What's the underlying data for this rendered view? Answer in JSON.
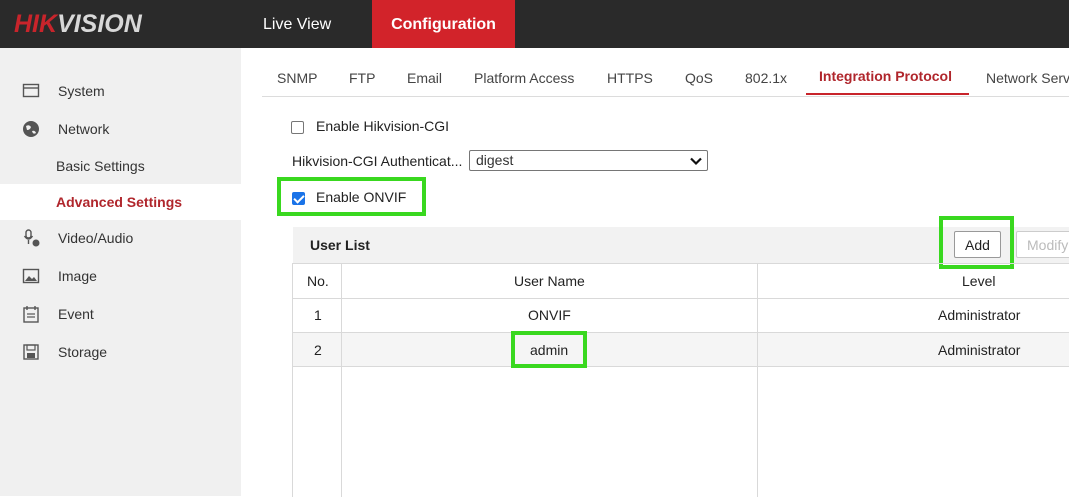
{
  "header": {
    "logo_red": "HIK",
    "logo_rest": "VISION",
    "nav": [
      {
        "label": "Live View"
      },
      {
        "label": "Configuration"
      }
    ]
  },
  "sidebar": {
    "items": [
      {
        "label": "System",
        "icon": "monitor-icon"
      },
      {
        "label": "Network",
        "icon": "globe-icon"
      },
      {
        "label": "Basic Settings"
      },
      {
        "label": "Advanced Settings"
      },
      {
        "label": "Video/Audio",
        "icon": "microphone-camera-icon"
      },
      {
        "label": "Image",
        "icon": "image-icon"
      },
      {
        "label": "Event",
        "icon": "calendar-icon"
      },
      {
        "label": "Storage",
        "icon": "disk-icon"
      }
    ]
  },
  "tabs": [
    "SNMP",
    "FTP",
    "Email",
    "Platform Access",
    "HTTPS",
    "QoS",
    "802.1x",
    "Integration Protocol",
    "Network Serv"
  ],
  "form": {
    "enable_cgi_label": "Enable Hikvision-CGI",
    "enable_cgi_checked": false,
    "auth_label": "Hikvision-CGI Authenticat...",
    "auth_value": "digest",
    "enable_onvif_label": "Enable ONVIF",
    "enable_onvif_checked": true
  },
  "user_list": {
    "title": "User List",
    "add_label": "Add",
    "modify_label": "Modify",
    "columns": [
      "No.",
      "User Name",
      "Level"
    ],
    "rows": [
      {
        "no": "1",
        "name": "ONVIF",
        "level": "Administrator"
      },
      {
        "no": "2",
        "name": "admin",
        "level": "Administrator"
      }
    ]
  },
  "colors": {
    "brand_red": "#d2232a",
    "highlight_green": "#39d81f",
    "checkbox_blue": "#1a73e8"
  }
}
